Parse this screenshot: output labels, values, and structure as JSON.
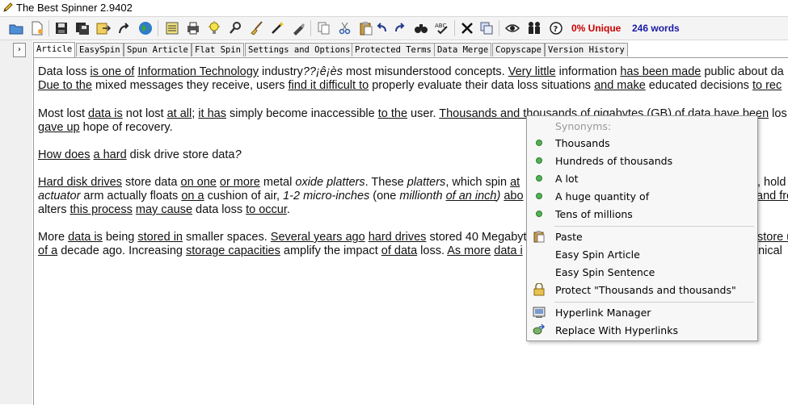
{
  "window": {
    "title": "The Best Spinner 2.9402"
  },
  "toolbar": {
    "icons": [
      "open-folder-icon",
      "new-document-icon",
      "save-icon",
      "save-as-icon",
      "export-icon",
      "redo-arrow-icon",
      "globe-icon",
      "list-icon",
      "print-icon",
      "lightbulb-icon",
      "tools-icon",
      "broom-icon",
      "magic-wand-icon",
      "pen-tool-icon",
      "copy-icon",
      "cut-icon",
      "paste-icon",
      "undo-icon",
      "redo-icon",
      "binoculars-icon",
      "spellcheck-icon",
      "close-x-icon",
      "duplicate-icon",
      "eye-icon",
      "people-icon",
      "help-icon"
    ],
    "unique": "0% Unique",
    "words": "246 words",
    "unique_color": "#cc0000",
    "words_color": "#1a1aa6"
  },
  "nav_arrow": "›",
  "tabs": [
    "Article",
    "EasySpin",
    "Spun Article",
    "Flat Spin",
    "Settings and Options",
    "Protected Terms",
    "Data Merge",
    "Copyscape",
    "Version History"
  ],
  "article": {
    "l1": [
      "Data loss ",
      "is one of",
      " ",
      "Information Technology",
      " industry",
      "??¡ê¡ès",
      " most misunderstood concepts. ",
      "Very little",
      " information ",
      "has been made",
      " public about da"
    ],
    "l2": [
      "Due to the",
      " mixed messages they receive, users ",
      "find it difficult to",
      " properly evaluate their data loss situations ",
      "and make",
      " educated decisions ",
      "to rec"
    ],
    "l3": [
      "Most lost ",
      "data is",
      " not lost ",
      "at all",
      "; ",
      "it has",
      " simply become inaccessible ",
      "to the",
      " user. ",
      "Thousands and thousands of gigabytes (GB) of data have been",
      " los"
    ],
    "l4": [
      "gave up",
      " hope of recovery."
    ],
    "l5": [
      "How does",
      " ",
      "a hard",
      " disk drive store data",
      "?"
    ],
    "l6": [
      "Hard disk drives",
      " store data ",
      "on one",
      " ",
      "or more",
      " metal ",
      "oxide platters",
      ". These ",
      "platters",
      ", which spin ",
      "at",
      "",
      ", hold"
    ],
    "l7": [
      "actuator",
      " arm actually floats ",
      "on a",
      " cushion of air, ",
      "1-2 micro-inches",
      " (one ",
      "millionth",
      " ",
      "of an inch",
      ") ",
      "abo",
      "and fro"
    ],
    "l8": [
      "alters ",
      "this process",
      " ",
      "may cause",
      " data loss ",
      "to occur",
      "."
    ],
    "l9": [
      "More ",
      "data is",
      " being ",
      "stored in",
      " smaller spaces. ",
      "Several years ago",
      " ",
      "hard drives",
      " stored 40 Megabyt",
      "store u"
    ],
    "l10": [
      "of a",
      " decade ago. Increasing ",
      "storage capacities",
      " amplify the impact ",
      "of data",
      " loss. ",
      "As more",
      " ",
      "data i",
      "anical"
    ]
  },
  "context_menu": {
    "header": "Synonyms:",
    "synonyms": [
      "Thousands",
      "Hundreds of thousands",
      "A lot",
      "A huge quantity of",
      "Tens of millions"
    ],
    "actions": [
      {
        "label": "Paste",
        "icon": "paste-icon"
      },
      {
        "label": "Easy Spin Article",
        "icon": ""
      },
      {
        "label": "Easy Spin Sentence",
        "icon": ""
      },
      {
        "label": "Protect \"Thousands and thousands\"",
        "icon": "lock-icon"
      }
    ],
    "links": [
      {
        "label": "Hyperlink Manager",
        "icon": "hyperlink-manager-icon"
      },
      {
        "label": "Replace With Hyperlinks",
        "icon": "replace-hyperlinks-icon"
      }
    ]
  }
}
